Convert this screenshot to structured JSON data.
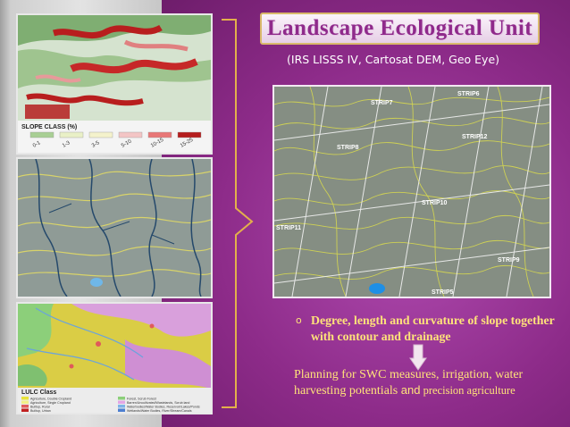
{
  "slide": {
    "title": "Landscape Ecological Unit",
    "subtitle": "(IRS LISSS IV, Cartosat DEM, Geo Eye)",
    "bullet": {
      "marker": "o",
      "text": "Degree, length and curvature of slope together with contour and drainage"
    },
    "planning": {
      "part1": "Planning  for SWC measures, irrigation, water harvesting potentials ",
      "part2": "and",
      "part3": " precision agriculture"
    }
  },
  "thumbnails": {
    "slope": {
      "legend_title": "SLOPE CLASS (%)",
      "legend_labels": [
        "0-1",
        "1-3",
        "3-5",
        "5-10",
        "10-15",
        "15-25"
      ],
      "legend_colors": [
        "#a8cf94",
        "#e9f0c7",
        "#f4f2cc",
        "#f3c5c5",
        "#e87777",
        "#b51e1e"
      ]
    },
    "lulc": {
      "legend_title": "LULC Class",
      "legend_items": [
        "Agriculture, Double Cropland",
        "Agriculture, Single Cropland",
        "Builtup, Rural",
        "Builtup, Urban",
        "Forest, Scrub Forest",
        "Barren/Uncultivated/Wastelands, Scrub land",
        "Waterbodies/Water Bodies, Reservoir/Lakes/Ponds",
        "Wetlands/Water Bodies, River/Stream/Canals"
      ],
      "legend_colors": [
        "#e7e33c",
        "#f2f088",
        "#e05a5a",
        "#c02020",
        "#8ccf7a",
        "#e3a6e6",
        "#7fb3e8",
        "#4d7fd1"
      ]
    }
  },
  "main_map": {
    "strip_labels": [
      "STRIP6",
      "STRIP12",
      "STRIP10",
      "STRIP11",
      "STRIP9",
      "STRIP5",
      "STRIP8",
      "STRIP7"
    ]
  },
  "colors": {
    "accent_purple": "#8f2a8b",
    "text_yellow": "#ffe27a",
    "bracket_yellow": "#e3b04b"
  }
}
